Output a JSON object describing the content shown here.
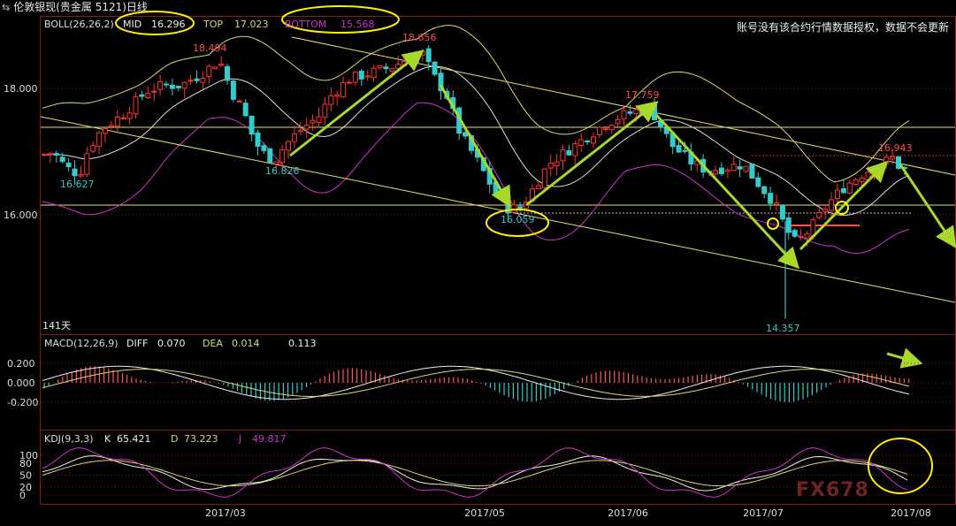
{
  "window": {
    "title": "伦敦银现(贵金属 5121)日线",
    "notice": "账号没有该合约行情数据授权，数据不会更新"
  },
  "watermark": "FX678",
  "chart_data": {
    "type": "candlestick",
    "main": {
      "indicator_label": "BOLL(26,26,2)",
      "mid_label": "MID",
      "mid_value": "16.296",
      "top_label": "TOP",
      "top_value": "17.023",
      "bottom_label": "BOTTOM",
      "bottom_value": "15.568",
      "yticks": [
        "18.000",
        "16.000"
      ],
      "ylim": [
        14.0,
        19.2
      ],
      "days_label": "141天",
      "annotations": [
        {
          "text": "18.494",
          "value": 18.494,
          "color": "#ff4d4d"
        },
        {
          "text": "18.656",
          "value": 18.656,
          "color": "#ff4d4d"
        },
        {
          "text": "17.759",
          "value": 17.759,
          "color": "#ff4d4d"
        },
        {
          "text": "16.943",
          "value": 16.943,
          "color": "#ff4d4d"
        },
        {
          "text": "16.627",
          "value": 16.627,
          "color": "#33cccc"
        },
        {
          "text": "16.826",
          "value": 16.826,
          "color": "#33cccc"
        },
        {
          "text": "16.059",
          "value": 16.059,
          "color": "#33cccc"
        },
        {
          "text": "14.357",
          "value": 14.357,
          "color": "#33cccc"
        }
      ]
    },
    "macd": {
      "label": "MACD(12,26,9)",
      "diff_label": "DIFF",
      "diff_value": "0.070",
      "dea_label": "DEA",
      "dea_value": "0.014",
      "macd_value": "0.113",
      "yticks": [
        "0.200",
        "0.000",
        "-0.200"
      ]
    },
    "kdj": {
      "label": "KDJ(9,3,3)",
      "k_label": "K",
      "k_value": "65.421",
      "d_label": "D",
      "d_value": "73.223",
      "j_label": "J",
      "j_value": "49.817",
      "yticks": [
        "100",
        "80",
        "50",
        "20",
        "0"
      ]
    },
    "xticks": [
      "2017/03",
      "2017/05",
      "2017/06",
      "2017/07",
      "2017/08"
    ],
    "colors": {
      "up": "#ff3333",
      "down": "#33cccc",
      "mid": "#dddddd",
      "upper": "#d8d877",
      "lower": "#cc33cc",
      "arrow": "#a8d82a",
      "highlight": "#ffee00"
    }
  }
}
